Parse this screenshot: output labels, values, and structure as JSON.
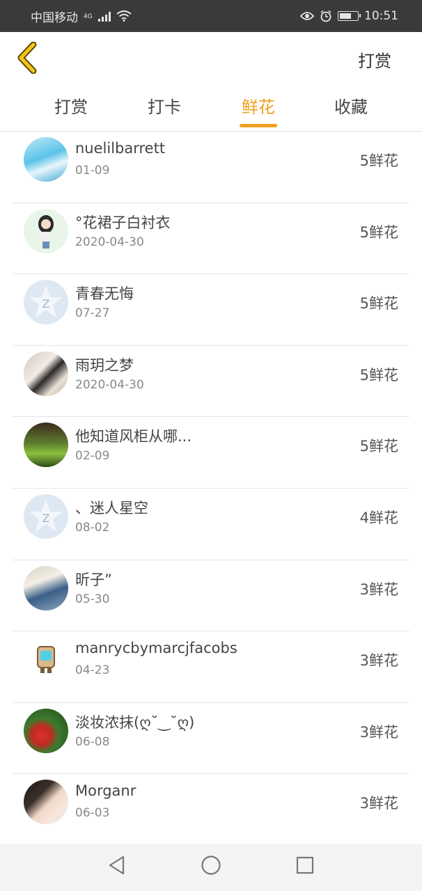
{
  "status_bar": {
    "carrier": "中国移动",
    "network": "4G",
    "time": "10:51"
  },
  "header": {
    "action_label": "打赏"
  },
  "tabs": [
    {
      "label": "打赏",
      "active": false
    },
    {
      "label": "打卡",
      "active": false
    },
    {
      "label": "鲜花",
      "active": true
    },
    {
      "label": "收藏",
      "active": false
    }
  ],
  "items": [
    {
      "name": "nuelilbarrett",
      "date": "01-09",
      "count": "5鲜花"
    },
    {
      "name": "°花裙子白衬衣",
      "date": "2020-04-30",
      "count": "5鲜花"
    },
    {
      "name": "青春无悔",
      "date": "07-27",
      "count": "5鲜花"
    },
    {
      "name": "雨玥之梦",
      "date": "2020-04-30",
      "count": "5鲜花"
    },
    {
      "name": "他知道风柜从哪...",
      "date": "02-09",
      "count": "5鲜花"
    },
    {
      "name": "、迷人星空",
      "date": "08-02",
      "count": "4鲜花"
    },
    {
      "name": "昕子”",
      "date": "05-30",
      "count": "3鲜花"
    },
    {
      "name": "manrycbymarcjfacobs",
      "date": "04-23",
      "count": "3鲜花"
    },
    {
      "name": "淡妆浓抹(ღ˘‿˘ღ)",
      "date": "06-08",
      "count": "3鲜花"
    },
    {
      "name": "Morganr",
      "date": "06-03",
      "count": "3鲜花"
    }
  ],
  "colors": {
    "accent": "#f0a01e",
    "back_arrow": "#f5c518",
    "status_bar_bg": "#3a3a3a"
  },
  "icons": {
    "back": "chevron-left-icon",
    "nav_back": "triangle-back-icon",
    "nav_home": "circle-home-icon",
    "nav_recent": "square-recent-icon"
  }
}
